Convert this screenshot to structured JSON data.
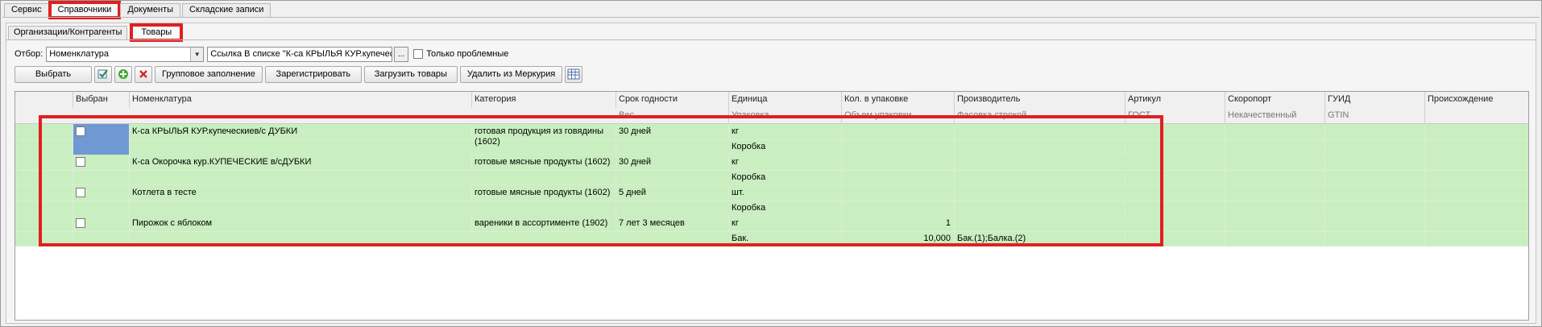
{
  "top_tabs": [
    "Сервис",
    "Справочники",
    "Документы",
    "Складские записи"
  ],
  "sub_tabs": [
    "Организации/Контрагенты",
    "Товары"
  ],
  "filter": {
    "label": "Отбор:",
    "field_value": "Номенклатура",
    "condition_value": "Ссылка В списке \"К-са КРЫЛЬЯ КУР.купечески...; К",
    "dots": "...",
    "problem_only_label": "Только проблемные",
    "problem_only_checked": false
  },
  "toolbar": {
    "select_label": "Выбрать",
    "group_fill_label": "Групповое заполнение",
    "register_label": "Зарегистрировать",
    "load_goods_label": "Загрузить товары",
    "delete_mercury_label": "Удалить из Меркурия"
  },
  "table": {
    "headers": [
      "Выбран",
      "Номенклатура",
      "Категория",
      "Срок годности",
      "Единица",
      "Кол. в упаковке",
      "Производитель",
      "Артикул",
      "Скоропорт",
      "ГУИД",
      "Происхождение"
    ],
    "subheaders": [
      "",
      "",
      "",
      "Вес",
      "Упаковка",
      "Объем упаковки",
      "Фасовка строкой",
      "ГОСТ",
      "Некачественный",
      "GTIN",
      ""
    ],
    "rows": [
      {
        "name": "К-са КРЫЛЬЯ КУР.купеческиев/с ДУБКИ",
        "category": "готовая продукция из говядины (1602)",
        "shelf_life": "30 дней",
        "unit": "кг",
        "package": "Коробка",
        "qty_in_pack": "",
        "pack_volume": "",
        "packing_string": "",
        "checked": false
      },
      {
        "name": "К-са Окорочка кур.КУПЕЧЕСКИЕ в/сДУБКИ",
        "category": "готовые мясные продукты (1602)",
        "shelf_life": "30 дней",
        "unit": "кг",
        "package": "Коробка",
        "qty_in_pack": "",
        "pack_volume": "",
        "packing_string": "",
        "checked": false
      },
      {
        "name": "Котлета в тесте",
        "category": "готовые мясные продукты (1602)",
        "shelf_life": "5 дней",
        "unit": "шт.",
        "package": "Коробка",
        "qty_in_pack": "",
        "pack_volume": "",
        "packing_string": "",
        "checked": false
      },
      {
        "name": "Пирожок с яблоком",
        "category": "вареники в ассортименте (1902)",
        "shelf_life": "7 лет 3 месяцев",
        "unit": "кг",
        "package": "Бак.",
        "qty_in_pack": "1",
        "pack_volume": "10,000",
        "packing_string": "Бак.(1);Балка.(2)",
        "checked": false
      }
    ]
  },
  "colors": {
    "row_bg": "#c9efc0",
    "highlight_cell": "#6f99d3",
    "annotation_red": "#e02020"
  }
}
